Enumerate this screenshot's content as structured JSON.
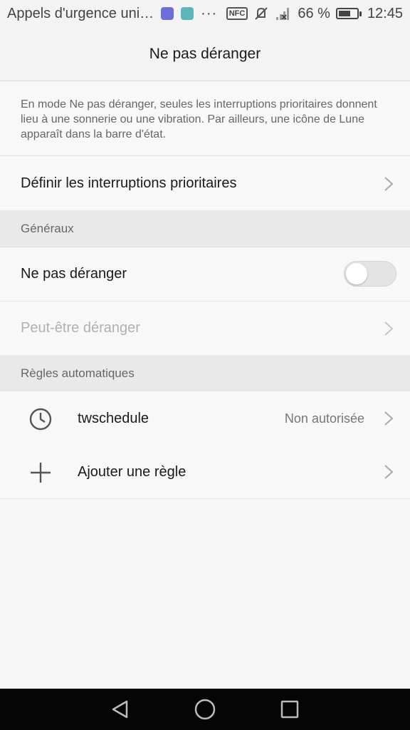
{
  "status_bar": {
    "carrier": "Appels d'urgence uni…",
    "notification_icons": [
      "pulse-app-icon",
      "gallery-app-icon"
    ],
    "more": "···",
    "nfc": "NFC",
    "battery_percent": "66 %",
    "battery_level": 0.66,
    "time": "12:45"
  },
  "header": {
    "title": "Ne pas déranger"
  },
  "description": "En mode Ne pas déranger, seules les interruptions prioritaires donnent lieu à une sonnerie ou une vibration. Par ailleurs, une icône de Lune apparaît dans la barre d'état.",
  "priority": {
    "label": "Définir les interruptions prioritaires"
  },
  "general": {
    "section_title": "Généraux",
    "dnd_label": "Ne pas déranger",
    "dnd_enabled": false,
    "maybe_label": "Peut-être déranger"
  },
  "rules": {
    "section_title": "Règles automatiques",
    "items": [
      {
        "label": "twschedule",
        "status": "Non autorisée",
        "icon": "clock-icon"
      },
      {
        "label": "Ajouter une règle",
        "status": "",
        "icon": "plus-icon"
      }
    ]
  },
  "nav": {
    "buttons": [
      "back-icon",
      "home-icon",
      "recents-icon"
    ]
  },
  "colors": {
    "background": "#f6f6f6",
    "section": "#e9e9e9",
    "navbar": "#050505",
    "disabled_text": "#b0b0b0"
  }
}
